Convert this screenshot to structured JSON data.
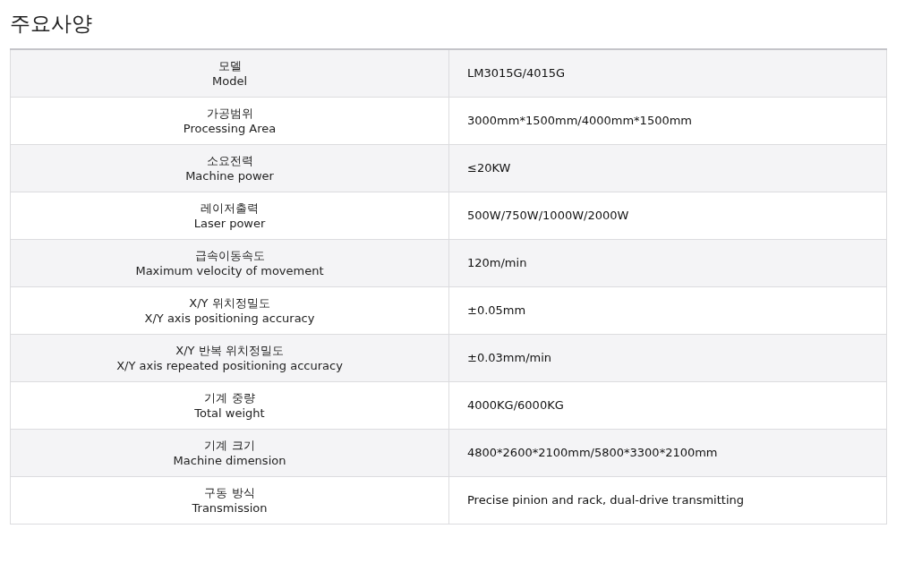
{
  "title": "주요사양",
  "rows": [
    {
      "label_ko": "모델",
      "label_en": "Model",
      "value": "LM3015G/4015G"
    },
    {
      "label_ko": "가공범위",
      "label_en": "Processing Area",
      "value": "3000mm*1500mm/4000mm*1500mm"
    },
    {
      "label_ko": "소요전력",
      "label_en": "Machine power",
      "value": "≤20KW"
    },
    {
      "label_ko": "레이저출력",
      "label_en": "Laser power",
      "value": "500W/750W/1000W/2000W"
    },
    {
      "label_ko": "급속이동속도",
      "label_en": "Maximum velocity of movement",
      "value": "120m/min"
    },
    {
      "label_ko": "X/Y 위치정밀도",
      "label_en": "X/Y axis positioning accuracy",
      "value": "±0.05mm"
    },
    {
      "label_ko": "X/Y 반복 위치정밀도",
      "label_en": "X/Y axis repeated positioning accuracy",
      "value": "±0.03mm/min"
    },
    {
      "label_ko": "기계 중량",
      "label_en": "Total weight",
      "value": "4000KG/6000KG"
    },
    {
      "label_ko": "기계 크기",
      "label_en": "Machine dimension",
      "value": "4800*2600*2100mm/5800*3300*2100mm"
    },
    {
      "label_ko": "구동 방식",
      "label_en": "Transmission",
      "value": "Precise pinion and rack, dual-drive transmitting"
    }
  ]
}
